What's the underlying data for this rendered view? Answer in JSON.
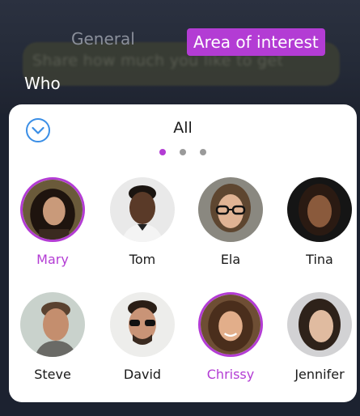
{
  "tabs": [
    {
      "label": "General",
      "active": false
    },
    {
      "label": "Area of interest",
      "active": true
    }
  ],
  "background_text": "Share how much you like to get",
  "who_label": "Who",
  "panel": {
    "title": "All",
    "pagination": {
      "pages": 3,
      "current": 1
    },
    "people": [
      {
        "name": "Mary",
        "selected": true
      },
      {
        "name": "Tom",
        "selected": false
      },
      {
        "name": "Ela",
        "selected": false
      },
      {
        "name": "Tina",
        "selected": false
      },
      {
        "name": "Steve",
        "selected": false
      },
      {
        "name": "David",
        "selected": false
      },
      {
        "name": "Chrissy",
        "selected": true
      },
      {
        "name": "Jennifer",
        "selected": false
      }
    ]
  },
  "colors": {
    "accent": "#b33cd4",
    "collapse_icon": "#3a8ee6",
    "background": "#1c2230",
    "panel": "#ffffff"
  }
}
